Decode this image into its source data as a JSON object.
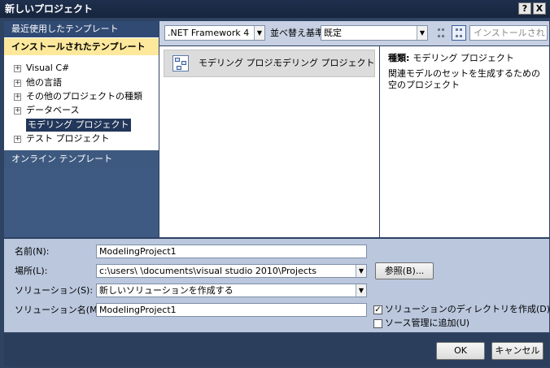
{
  "window": {
    "title": "新しいプロジェクト",
    "help_label": "?",
    "close_label": "X"
  },
  "left": {
    "recent": "最近使用したテンプレート",
    "installed": "インストールされたテンプレート",
    "items": [
      {
        "label": "Visual C#",
        "expander": "+"
      },
      {
        "label": "他の言語",
        "expander": "+"
      },
      {
        "label": "その他のプロジェクトの種類",
        "expander": "+"
      },
      {
        "label": "データベース",
        "expander": "+"
      },
      {
        "label": "モデリング プロジェクト",
        "expander": ""
      },
      {
        "label": "テスト プロジェクト",
        "expander": "+"
      }
    ],
    "online": "オンライン テンプレート"
  },
  "toolbar": {
    "framework": ".NET Framework 4",
    "sort_label": "並べ替え基準:",
    "sort_value": "既定",
    "search_placeholder": "インストールされ"
  },
  "templates": [
    {
      "name": "モデリング プロジ...",
      "type": "モデリング プロジェクト"
    }
  ],
  "details": {
    "type_label": "種類:",
    "type_value": "モデリング プロジェクト",
    "description": "関連モデルのセットを生成するための空のプロジェクト"
  },
  "form": {
    "name_label": "名前(N):",
    "name_value": "ModelingProject1",
    "location_label": "場所(L):",
    "location_value": "c:\\users\\         \\documents\\visual studio 2010\\Projects",
    "solution_label": "ソリューション(S):",
    "solution_value": "新しいソリューションを作成する",
    "solution_name_label": "ソリューション名(M):",
    "solution_name_value": "ModelingProject1",
    "browse_label": "参照(B)...",
    "create_dir_label": "ソリューションのディレクトリを作成(D)",
    "create_dir_checked": true,
    "source_control_label": "ソース管理に追加(U)",
    "source_control_checked": false
  },
  "buttons": {
    "ok": "OK",
    "cancel": "キャンセル"
  }
}
